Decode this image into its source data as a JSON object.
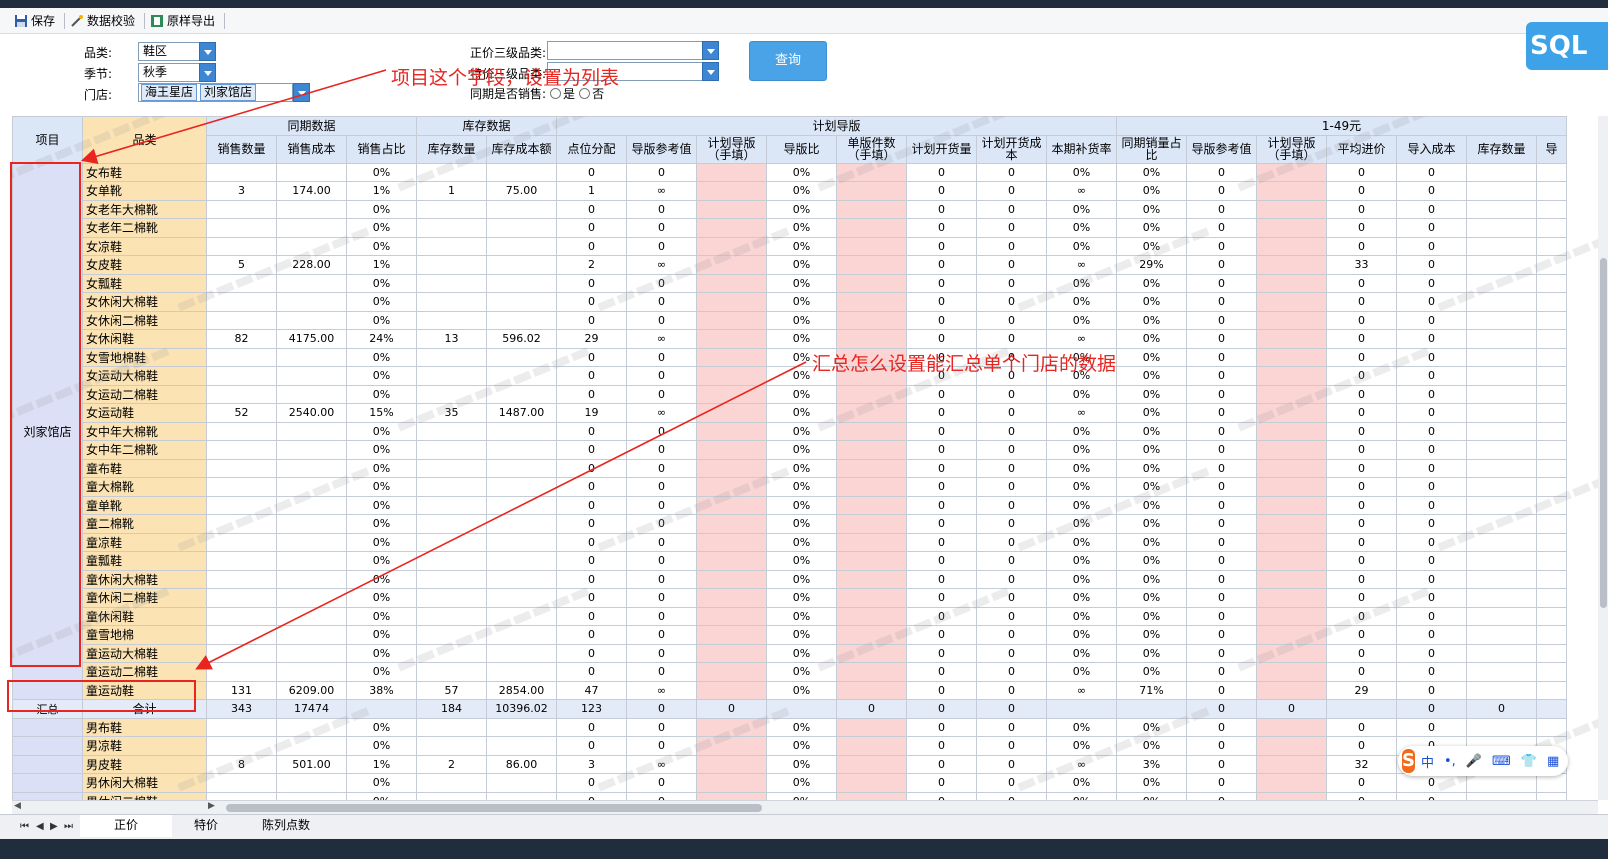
{
  "toolbar": {
    "save": "保存",
    "validate": "数据校验",
    "export": "原样导出"
  },
  "filters": {
    "category_label": "品类:",
    "category_value": "鞋区",
    "season_label": "季节:",
    "season_value": "秋季",
    "store_label": "门店:",
    "stores": [
      "海王星店",
      "刘家馆店"
    ],
    "level3_label": "正价三级品类:",
    "level3_value": "",
    "special_label": "特价三级品类:",
    "special_value": "",
    "same_period_label": "同期是否销售:",
    "opt_yes": "是",
    "opt_no": "否",
    "query": "查询",
    "sql": "SQL"
  },
  "grid": {
    "header_groups": {
      "project": "项目",
      "category": "品类",
      "same_period": "同期数据",
      "inventory": "库存数据",
      "plan": "计划导版",
      "price_band": "1-49元"
    },
    "columns": [
      "销售数量",
      "销售成本",
      "销售占比",
      "库存数量",
      "库存成本额",
      "点位分配",
      "导版参考值",
      "计划导版（手填）",
      "导版比",
      "单版件数（手填）",
      "计划开货量",
      "计划开货成本",
      "本期补货率",
      "同期销量占比",
      "导版参考值",
      "计划导版（手填）",
      "平均进价",
      "导入成本",
      "库存数量",
      "导"
    ],
    "project_store": "刘家馆店",
    "summary_label": "汇总",
    "summary_cat": "合计",
    "rows": [
      {
        "cat": "女布鞋",
        "v": [
          "",
          "",
          "0%",
          "",
          "",
          "0",
          "0",
          "",
          "0%",
          "",
          "0",
          "0",
          "0%",
          "0%",
          "0",
          "",
          "0",
          "0",
          "",
          ""
        ]
      },
      {
        "cat": "女单靴",
        "v": [
          "3",
          "174.00",
          "1%",
          "1",
          "75.00",
          "1",
          "∞",
          "",
          "0%",
          "",
          "0",
          "0",
          "∞",
          "0%",
          "0",
          "",
          "0",
          "0",
          "",
          ""
        ]
      },
      {
        "cat": "女老年大棉靴",
        "v": [
          "",
          "",
          "0%",
          "",
          "",
          "0",
          "0",
          "",
          "0%",
          "",
          "0",
          "0",
          "0%",
          "0%",
          "0",
          "",
          "0",
          "0",
          "",
          ""
        ]
      },
      {
        "cat": "女老年二棉靴",
        "v": [
          "",
          "",
          "0%",
          "",
          "",
          "0",
          "0",
          "",
          "0%",
          "",
          "0",
          "0",
          "0%",
          "0%",
          "0",
          "",
          "0",
          "0",
          "",
          ""
        ]
      },
      {
        "cat": "女凉鞋",
        "v": [
          "",
          "",
          "0%",
          "",
          "",
          "0",
          "0",
          "",
          "0%",
          "",
          "0",
          "0",
          "0%",
          "0%",
          "0",
          "",
          "0",
          "0",
          "",
          ""
        ]
      },
      {
        "cat": "女皮鞋",
        "v": [
          "5",
          "228.00",
          "1%",
          "",
          "",
          "2",
          "∞",
          "",
          "0%",
          "",
          "0",
          "0",
          "∞",
          "29%",
          "0",
          "",
          "33",
          "0",
          "",
          ""
        ]
      },
      {
        "cat": "女瓢鞋",
        "v": [
          "",
          "",
          "0%",
          "",
          "",
          "0",
          "0",
          "",
          "0%",
          "",
          "0",
          "0",
          "0%",
          "0%",
          "0",
          "",
          "0",
          "0",
          "",
          ""
        ]
      },
      {
        "cat": "女休闲大棉鞋",
        "v": [
          "",
          "",
          "0%",
          "",
          "",
          "0",
          "0",
          "",
          "0%",
          "",
          "0",
          "0",
          "0%",
          "0%",
          "0",
          "",
          "0",
          "0",
          "",
          ""
        ]
      },
      {
        "cat": "女休闲二棉鞋",
        "v": [
          "",
          "",
          "0%",
          "",
          "",
          "0",
          "0",
          "",
          "0%",
          "",
          "0",
          "0",
          "0%",
          "0%",
          "0",
          "",
          "0",
          "0",
          "",
          ""
        ]
      },
      {
        "cat": "女休闲鞋",
        "v": [
          "82",
          "4175.00",
          "24%",
          "13",
          "596.02",
          "29",
          "∞",
          "",
          "0%",
          "",
          "0",
          "0",
          "∞",
          "0%",
          "0",
          "",
          "0",
          "0",
          "",
          ""
        ]
      },
      {
        "cat": "女雪地棉鞋",
        "v": [
          "",
          "",
          "0%",
          "",
          "",
          "0",
          "0",
          "",
          "0%",
          "",
          "0",
          "0",
          "0%",
          "0%",
          "0",
          "",
          "0",
          "0",
          "",
          ""
        ]
      },
      {
        "cat": "女运动大棉鞋",
        "v": [
          "",
          "",
          "0%",
          "",
          "",
          "0",
          "0",
          "",
          "0%",
          "",
          "0",
          "0",
          "0%",
          "0%",
          "0",
          "",
          "0",
          "0",
          "",
          ""
        ]
      },
      {
        "cat": "女运动二棉鞋",
        "v": [
          "",
          "",
          "0%",
          "",
          "",
          "0",
          "0",
          "",
          "0%",
          "",
          "0",
          "0",
          "0%",
          "0%",
          "0",
          "",
          "0",
          "0",
          "",
          ""
        ]
      },
      {
        "cat": "女运动鞋",
        "v": [
          "52",
          "2540.00",
          "15%",
          "35",
          "1487.00",
          "19",
          "∞",
          "",
          "0%",
          "",
          "0",
          "0",
          "∞",
          "0%",
          "0",
          "",
          "0",
          "0",
          "",
          ""
        ]
      },
      {
        "cat": "女中年大棉靴",
        "v": [
          "",
          "",
          "0%",
          "",
          "",
          "0",
          "0",
          "",
          "0%",
          "",
          "0",
          "0",
          "0%",
          "0%",
          "0",
          "",
          "0",
          "0",
          "",
          ""
        ]
      },
      {
        "cat": "女中年二棉靴",
        "v": [
          "",
          "",
          "0%",
          "",
          "",
          "0",
          "0",
          "",
          "0%",
          "",
          "0",
          "0",
          "0%",
          "0%",
          "0",
          "",
          "0",
          "0",
          "",
          ""
        ]
      },
      {
        "cat": "童布鞋",
        "v": [
          "",
          "",
          "0%",
          "",
          "",
          "0",
          "0",
          "",
          "0%",
          "",
          "0",
          "0",
          "0%",
          "0%",
          "0",
          "",
          "0",
          "0",
          "",
          ""
        ]
      },
      {
        "cat": "童大棉靴",
        "v": [
          "",
          "",
          "0%",
          "",
          "",
          "0",
          "0",
          "",
          "0%",
          "",
          "0",
          "0",
          "0%",
          "0%",
          "0",
          "",
          "0",
          "0",
          "",
          ""
        ]
      },
      {
        "cat": "童单靴",
        "v": [
          "",
          "",
          "0%",
          "",
          "",
          "0",
          "0",
          "",
          "0%",
          "",
          "0",
          "0",
          "0%",
          "0%",
          "0",
          "",
          "0",
          "0",
          "",
          ""
        ]
      },
      {
        "cat": "童二棉靴",
        "v": [
          "",
          "",
          "0%",
          "",
          "",
          "0",
          "0",
          "",
          "0%",
          "",
          "0",
          "0",
          "0%",
          "0%",
          "0",
          "",
          "0",
          "0",
          "",
          ""
        ]
      },
      {
        "cat": "童凉鞋",
        "v": [
          "",
          "",
          "0%",
          "",
          "",
          "0",
          "0",
          "",
          "0%",
          "",
          "0",
          "0",
          "0%",
          "0%",
          "0",
          "",
          "0",
          "0",
          "",
          ""
        ]
      },
      {
        "cat": "童瓢鞋",
        "v": [
          "",
          "",
          "0%",
          "",
          "",
          "0",
          "0",
          "",
          "0%",
          "",
          "0",
          "0",
          "0%",
          "0%",
          "0",
          "",
          "0",
          "0",
          "",
          ""
        ]
      },
      {
        "cat": "童休闲大棉鞋",
        "v": [
          "",
          "",
          "0%",
          "",
          "",
          "0",
          "0",
          "",
          "0%",
          "",
          "0",
          "0",
          "0%",
          "0%",
          "0",
          "",
          "0",
          "0",
          "",
          ""
        ]
      },
      {
        "cat": "童休闲二棉鞋",
        "v": [
          "",
          "",
          "0%",
          "",
          "",
          "0",
          "0",
          "",
          "0%",
          "",
          "0",
          "0",
          "0%",
          "0%",
          "0",
          "",
          "0",
          "0",
          "",
          ""
        ]
      },
      {
        "cat": "童休闲鞋",
        "v": [
          "",
          "",
          "0%",
          "",
          "",
          "0",
          "0",
          "",
          "0%",
          "",
          "0",
          "0",
          "0%",
          "0%",
          "0",
          "",
          "0",
          "0",
          "",
          ""
        ]
      },
      {
        "cat": "童雪地棉",
        "v": [
          "",
          "",
          "0%",
          "",
          "",
          "0",
          "0",
          "",
          "0%",
          "",
          "0",
          "0",
          "0%",
          "0%",
          "0",
          "",
          "0",
          "0",
          "",
          ""
        ]
      },
      {
        "cat": "童运动大棉鞋",
        "v": [
          "",
          "",
          "0%",
          "",
          "",
          "0",
          "0",
          "",
          "0%",
          "",
          "0",
          "0",
          "0%",
          "0%",
          "0",
          "",
          "0",
          "0",
          "",
          ""
        ]
      },
      {
        "cat": "童运动二棉鞋",
        "v": [
          "",
          "",
          "0%",
          "",
          "",
          "0",
          "0",
          "",
          "0%",
          "",
          "0",
          "0",
          "0%",
          "0%",
          "0",
          "",
          "0",
          "0",
          "",
          ""
        ]
      },
      {
        "cat": "童运动鞋",
        "v": [
          "131",
          "6209.00",
          "38%",
          "57",
          "2854.00",
          "47",
          "∞",
          "",
          "0%",
          "",
          "0",
          "0",
          "∞",
          "71%",
          "0",
          "",
          "29",
          "0",
          "",
          ""
        ]
      }
    ],
    "summary": [
      "343",
      "17474",
      "",
      "184",
      "10396.02",
      "123",
      "0",
      "0",
      "",
      "0",
      "0",
      "0",
      "",
      "",
      "0",
      "0",
      "",
      "0",
      "0",
      ""
    ],
    "after_rows": [
      {
        "cat": "男布鞋",
        "v": [
          "",
          "",
          "0%",
          "",
          "",
          "0",
          "0",
          "",
          "0%",
          "",
          "0",
          "0",
          "0%",
          "0%",
          "0",
          "",
          "0",
          "0",
          "",
          ""
        ]
      },
      {
        "cat": "男凉鞋",
        "v": [
          "",
          "",
          "0%",
          "",
          "",
          "0",
          "0",
          "",
          "0%",
          "",
          "0",
          "0",
          "0%",
          "0%",
          "0",
          "",
          "0",
          "0",
          "",
          ""
        ]
      },
      {
        "cat": "男皮鞋",
        "v": [
          "8",
          "501.00",
          "1%",
          "2",
          "86.00",
          "3",
          "∞",
          "",
          "0%",
          "",
          "0",
          "0",
          "∞",
          "3%",
          "0",
          "",
          "32",
          "0",
          "",
          ""
        ]
      },
      {
        "cat": "男休闲大棉鞋",
        "v": [
          "",
          "",
          "0%",
          "",
          "",
          "0",
          "0",
          "",
          "0%",
          "",
          "0",
          "0",
          "0%",
          "0%",
          "0",
          "",
          "0",
          "0",
          "",
          ""
        ]
      },
      {
        "cat": "男休闲二棉鞋",
        "v": [
          "",
          "",
          "0%",
          "",
          "",
          "0",
          "0",
          "",
          "0%",
          "",
          "0",
          "0",
          "0%",
          "0%",
          "0",
          "",
          "0",
          "0",
          "",
          ""
        ]
      }
    ]
  },
  "annotations": {
    "note1": "项目这个字段，设置为列表",
    "note2": "汇总怎么设置能汇总单个门店的数据"
  },
  "sheets": [
    "正价",
    "特价",
    "陈列点数"
  ],
  "ime": {
    "cn": "中",
    "punct": "•,"
  },
  "colors": {
    "accent": "#3c86d4",
    "annotation": "#e8251f",
    "category_bg": "#fce3b4",
    "project_bg": "#dce0f6",
    "manual_bg": "#fbd4d4",
    "header_bg": "#dbe6f7"
  }
}
